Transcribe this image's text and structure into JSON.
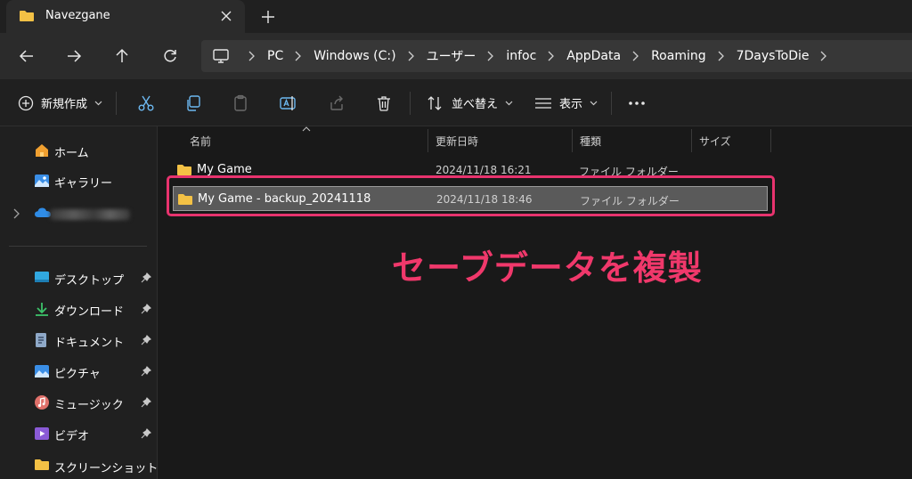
{
  "window": {
    "tab_title": "Navezgane",
    "icons": {
      "folder": "folder-icon",
      "close": "close-icon",
      "new_tab": "plus-icon"
    }
  },
  "navigation": {
    "buttons": [
      "back-icon",
      "forward-icon",
      "up-icon",
      "refresh-icon"
    ],
    "breadcrumbs": [
      "PC",
      "Windows (C:)",
      "ユーザー",
      "infoc",
      "AppData",
      "Roaming",
      "7DaysToDie"
    ]
  },
  "toolbar": {
    "new_label": "新規作成",
    "sort_label": "並べ替え",
    "view_label": "表示",
    "icons": [
      "cut-icon",
      "copy-icon",
      "paste-icon",
      "rename-icon",
      "share-icon",
      "delete-icon"
    ]
  },
  "sidebar": {
    "items": [
      {
        "label": "ホーム",
        "icon": "home-icon"
      },
      {
        "label": "ギャラリー",
        "icon": "gallery-icon"
      }
    ],
    "onedrive_icon": "cloud-icon",
    "quick_access": [
      {
        "label": "デスクトップ",
        "icon": "desktop-icon",
        "pinned": true
      },
      {
        "label": "ダウンロード",
        "icon": "download-icon",
        "pinned": true
      },
      {
        "label": "ドキュメント",
        "icon": "document-icon",
        "pinned": true
      },
      {
        "label": "ピクチャ",
        "icon": "picture-icon",
        "pinned": true
      },
      {
        "label": "ミュージック",
        "icon": "music-icon",
        "pinned": true
      },
      {
        "label": "ビデオ",
        "icon": "video-icon",
        "pinned": true
      },
      {
        "label": "スクリーンショット",
        "icon": "folder-icon",
        "pinned": false
      }
    ]
  },
  "file_list": {
    "columns": [
      "名前",
      "更新日時",
      "種類",
      "サイズ"
    ],
    "rows": [
      {
        "name": "My Game",
        "modified": "2024/11/18 16:21",
        "type": "ファイル フォルダー",
        "selected": false
      },
      {
        "name": "My Game - backup_20241118",
        "modified": "2024/11/18 18:46",
        "type": "ファイル フォルダー",
        "selected": true
      }
    ]
  },
  "annotation": {
    "text": "セーブデータを複製",
    "color": "#f0386b"
  },
  "colors": {
    "accent_highlight": "#e8336e",
    "folder": "#f3c145",
    "background": "#191919"
  }
}
